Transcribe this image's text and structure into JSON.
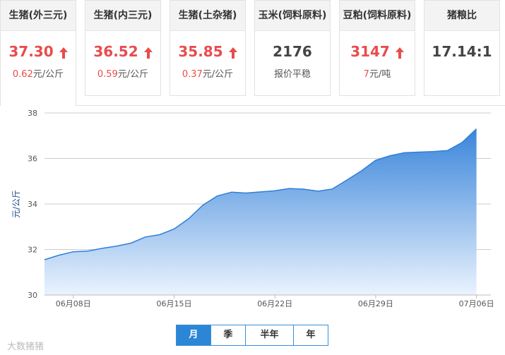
{
  "cards": [
    {
      "title": "生猪(外三元)",
      "value": "37.30",
      "arrow": true,
      "change": "0.62",
      "change_suffix": "元/公斤",
      "active": true
    },
    {
      "title": "生猪(内三元)",
      "value": "36.52",
      "arrow": true,
      "change": "0.59",
      "change_suffix": "元/公斤"
    },
    {
      "title": "生猪(土杂猪)",
      "value": "35.85",
      "arrow": true,
      "change": "0.37",
      "change_suffix": "元/公斤"
    },
    {
      "title": "玉米(饲料原料)",
      "value": "2176",
      "arrow": false,
      "note": "报价平稳"
    },
    {
      "title": "豆粕(饲料原料)",
      "value": "3147",
      "arrow": true,
      "change": "7",
      "change_suffix": "元/吨"
    },
    {
      "title": "猪粮比",
      "value": "17.14:1",
      "arrow": false
    }
  ],
  "colors": {
    "up": "#e84c4c",
    "line": "#2f7fd6",
    "fill_top": "#3a85db",
    "fill_bottom": "#eaf3fd",
    "grid": "#cccccc"
  },
  "chart_data": {
    "type": "area",
    "ylabel": "元/公斤",
    "ylim": [
      30,
      38
    ],
    "yticks": [
      "30",
      "32",
      "34",
      "36",
      "38"
    ],
    "x_tick_labels": [
      {
        "day": 0,
        "label": "06月08日"
      },
      {
        "day": 7,
        "label": "06月15日"
      },
      {
        "day": 14,
        "label": "06月22日"
      },
      {
        "day": 21,
        "label": "06月29日"
      },
      {
        "day": 28,
        "label": "07月06日"
      }
    ],
    "x_range": [
      -2,
      29
    ],
    "series": [
      {
        "values": [
          [
            -2,
            31.55
          ],
          [
            -1,
            31.75
          ],
          [
            0,
            31.9
          ],
          [
            1,
            31.93
          ],
          [
            2,
            32.05
          ],
          [
            3,
            32.15
          ],
          [
            4,
            32.28
          ],
          [
            5,
            32.55
          ],
          [
            6,
            32.65
          ],
          [
            7,
            32.9
          ],
          [
            8,
            33.35
          ],
          [
            9,
            33.95
          ],
          [
            10,
            34.35
          ],
          [
            11,
            34.52
          ],
          [
            12,
            34.48
          ],
          [
            13,
            34.53
          ],
          [
            14,
            34.58
          ],
          [
            15,
            34.68
          ],
          [
            16,
            34.65
          ],
          [
            17,
            34.56
          ],
          [
            18,
            34.66
          ],
          [
            19,
            35.05
          ],
          [
            20,
            35.45
          ],
          [
            21,
            35.92
          ],
          [
            22,
            36.12
          ],
          [
            23,
            36.25
          ],
          [
            24,
            36.28
          ],
          [
            25,
            36.3
          ],
          [
            26,
            36.35
          ],
          [
            27,
            36.7
          ],
          [
            28,
            37.3
          ]
        ]
      }
    ]
  },
  "periods": [
    {
      "label": "月",
      "active": true
    },
    {
      "label": "季",
      "active": false
    },
    {
      "label": "半年",
      "active": false
    },
    {
      "label": "年",
      "active": false
    }
  ],
  "watermark": "大数猪猪"
}
